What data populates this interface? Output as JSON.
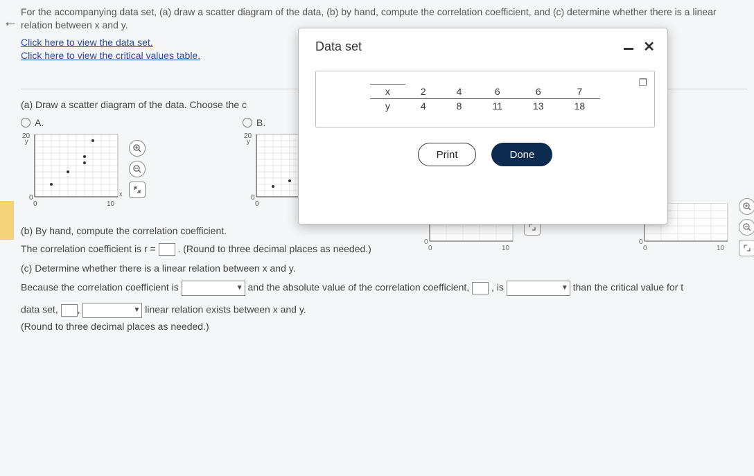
{
  "nav": {
    "back": "←"
  },
  "problem": {
    "text": "For the accompanying data set, (a) draw a scatter diagram of the data, (b) by hand, compute the correlation coefficient, and (c) determine whether there is a linear relation between x and y.",
    "link1": "Click here to view the data set.",
    "link2": "Click here to view the critical values table."
  },
  "partA": {
    "prompt": "(a) Draw a scatter diagram of the data. Choose the c",
    "optionA": "A.",
    "optionB": "B."
  },
  "axes": {
    "ylabel": "y",
    "xmin": "0",
    "xmax": "10",
    "ymax": "20",
    "ymin": "0"
  },
  "partB": {
    "heading": "(b) By hand, compute the correlation coefficient.",
    "line": "The correlation coefficient is r = ",
    "rounding": ". (Round to three decimal places as needed.)"
  },
  "partC": {
    "heading": "(c) Determine whether there is a linear relation between x and y.",
    "s1a": "Because the correlation coefficient is ",
    "s1b": " and the absolute value of the correlation coefficient, ",
    "s1c": ", is ",
    "s1d": " than the critical value for t",
    "s2a": "data set, ",
    "s2b": " linear relation exists between x and y.",
    "rounding": "(Round to three decimal places as needed.)"
  },
  "modal": {
    "title": "Data set",
    "print": "Print",
    "done": "Done"
  },
  "chart_data": {
    "type": "table",
    "title": "Data set",
    "row_labels": [
      "x",
      "y"
    ],
    "columns": [
      {
        "x": 2,
        "y": 4
      },
      {
        "x": 4,
        "y": 8
      },
      {
        "x": 6,
        "y": 11
      },
      {
        "x": 6,
        "y": 13
      },
      {
        "x": 7,
        "y": 18
      }
    ]
  },
  "icons": {
    "zoom_in": "⦿",
    "zoom_out": "⦾",
    "expand": "⤢",
    "copy": "❐"
  }
}
